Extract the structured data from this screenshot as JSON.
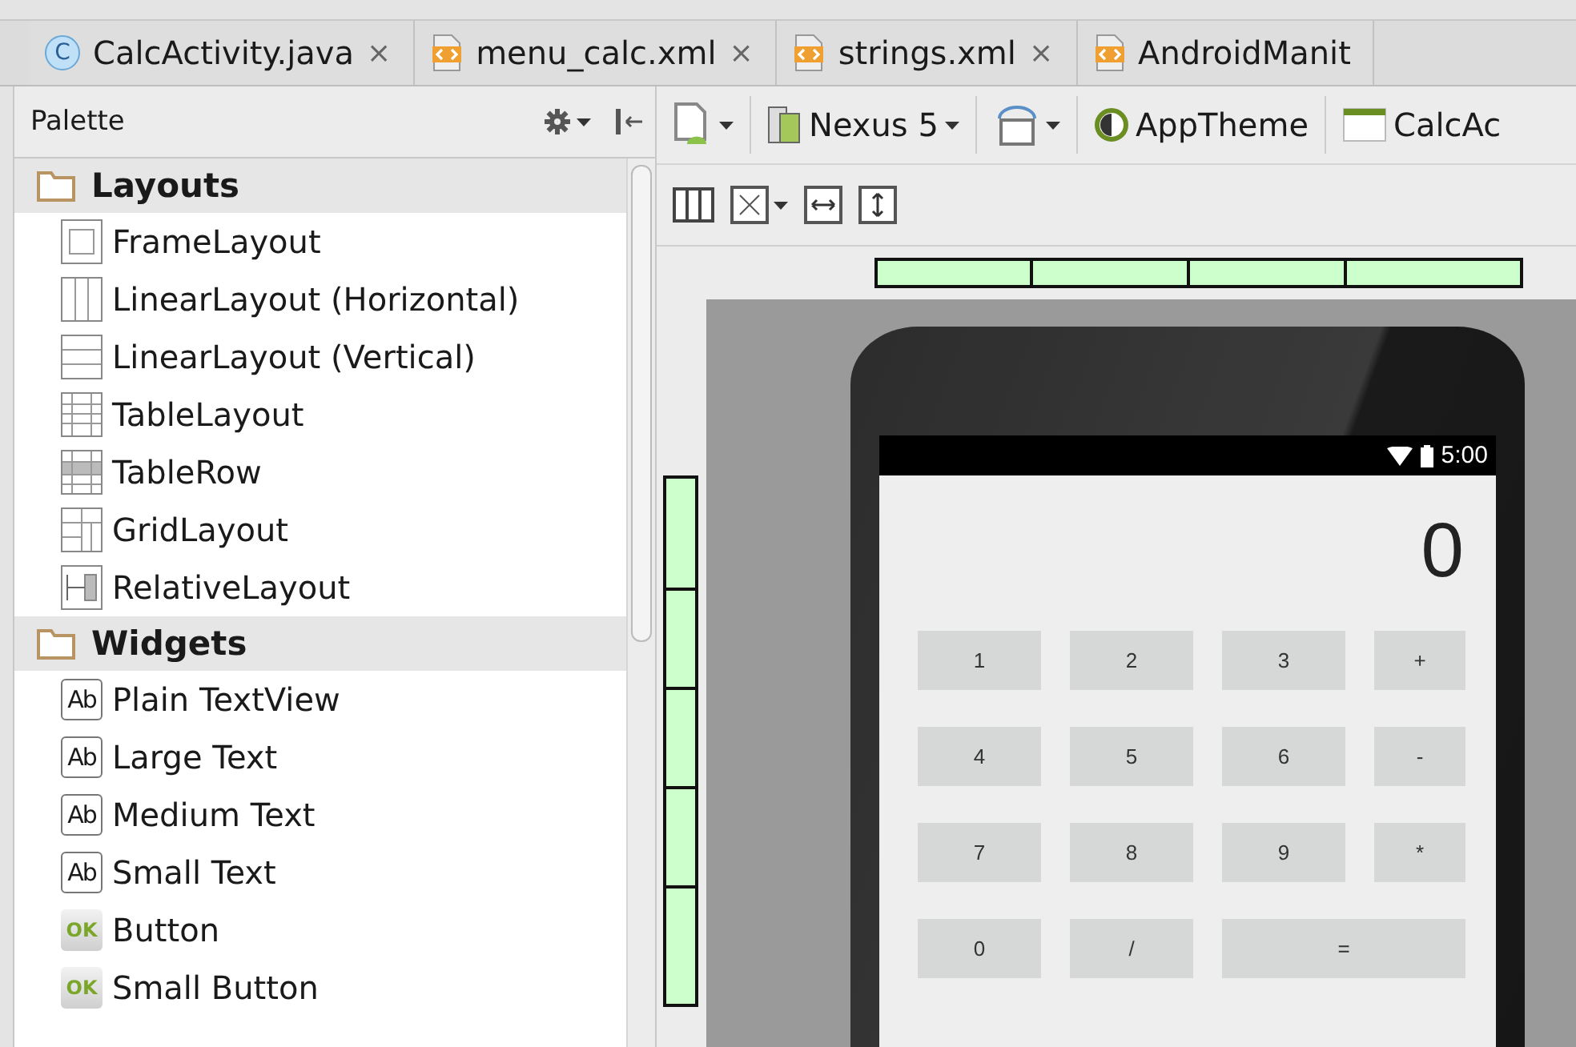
{
  "tabs": [
    {
      "label": "CalcActivity.java",
      "kind": "class",
      "glyph": "C",
      "close": "×"
    },
    {
      "label": "menu_calc.xml",
      "kind": "xml",
      "close": "×"
    },
    {
      "label": "strings.xml",
      "kind": "xml",
      "close": "×"
    },
    {
      "label": "AndroidManit",
      "kind": "xml"
    }
  ],
  "palette": {
    "title": "Palette",
    "groups": [
      {
        "label": "Layouts",
        "children": [
          {
            "label": "FrameLayout",
            "kind": "frame"
          },
          {
            "label": "LinearLayout (Horizontal)",
            "kind": "linear_h"
          },
          {
            "label": "LinearLayout (Vertical)",
            "kind": "linear_v"
          },
          {
            "label": "TableLayout",
            "kind": "table"
          },
          {
            "label": "TableRow",
            "kind": "tablerow"
          },
          {
            "label": "GridLayout",
            "kind": "grid"
          },
          {
            "label": "RelativeLayout",
            "kind": "relative"
          }
        ]
      },
      {
        "label": "Widgets",
        "children": [
          {
            "label": "Plain TextView",
            "kind": "text",
            "badge": "Ab"
          },
          {
            "label": "Large Text",
            "kind": "text",
            "badge": "Ab"
          },
          {
            "label": "Medium Text",
            "kind": "text",
            "badge": "Ab"
          },
          {
            "label": "Small Text",
            "kind": "text",
            "badge": "Ab"
          },
          {
            "label": "Button",
            "kind": "button",
            "badge": "OK"
          },
          {
            "label": "Small Button",
            "kind": "button",
            "badge": "OK"
          }
        ]
      }
    ]
  },
  "toolbar": {
    "device": "Nexus 5",
    "theme": "AppTheme",
    "activity": "CalcAc"
  },
  "phone": {
    "time": "5:00",
    "display": "0",
    "keys": [
      {
        "label": "1",
        "kind": "normal"
      },
      {
        "label": "2",
        "kind": "normal"
      },
      {
        "label": "3",
        "kind": "normal"
      },
      {
        "label": "+",
        "kind": "normal"
      },
      {
        "label": "4",
        "kind": "normal"
      },
      {
        "label": "5",
        "kind": "normal"
      },
      {
        "label": "6",
        "kind": "normal"
      },
      {
        "label": "-",
        "kind": "normal"
      },
      {
        "label": "7",
        "kind": "normal"
      },
      {
        "label": "8",
        "kind": "normal"
      },
      {
        "label": "9",
        "kind": "normal"
      },
      {
        "label": "*",
        "kind": "normal"
      },
      {
        "label": "0",
        "kind": "normal"
      },
      {
        "label": "/",
        "kind": "normal"
      },
      {
        "label": "=",
        "kind": "wide"
      }
    ]
  }
}
